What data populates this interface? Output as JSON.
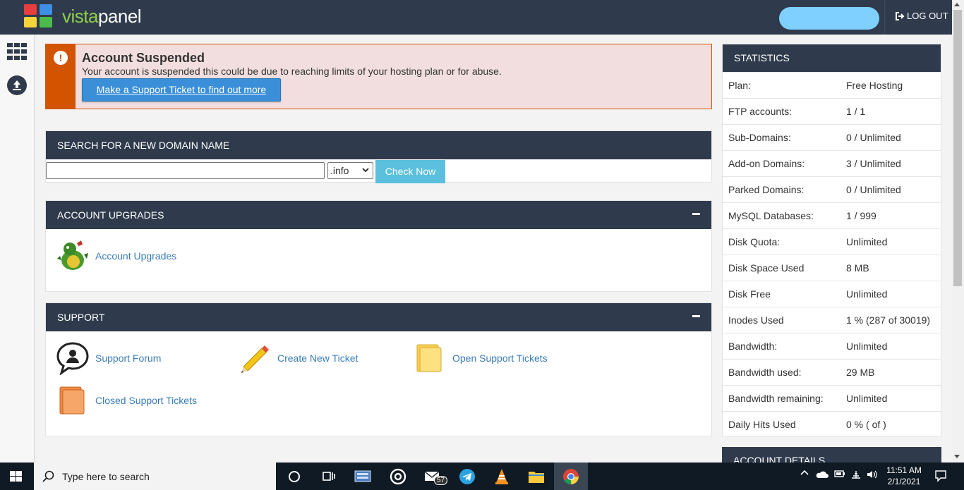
{
  "header": {
    "logo_text": "vistapanel",
    "logout_label": "LOG OUT"
  },
  "alert": {
    "title": "Account Suspended",
    "message": "Your account is suspended this could be due to reaching limits of your hosting plan or for abuse.",
    "button_label": "Make a Support Ticket to find out more"
  },
  "domain_search": {
    "heading": "SEARCH FOR A NEW DOMAIN NAME",
    "input_value": "",
    "tld_selected": ".info",
    "button_label": "Check Now"
  },
  "upgrades": {
    "heading": "ACCOUNT UPGRADES",
    "link_label": "Account Upgrades"
  },
  "support": {
    "heading": "SUPPORT",
    "forum": "Support Forum",
    "new_ticket": "Create New Ticket",
    "open_tickets": "Open Support Tickets",
    "closed_tickets": "Closed Support Tickets"
  },
  "statistics": {
    "heading": "STATISTICS",
    "rows": [
      {
        "label": "Plan:",
        "value": "Free Hosting"
      },
      {
        "label": "FTP accounts:",
        "value": "1 / 1"
      },
      {
        "label": "Sub-Domains:",
        "value": "0 / Unlimited"
      },
      {
        "label": "Add-on Domains:",
        "value": "3 / Unlimited"
      },
      {
        "label": "Parked Domains:",
        "value": "0 / Unlimited"
      },
      {
        "label": "MySQL Databases:",
        "value": "1 / 999"
      },
      {
        "label": "Disk Quota:",
        "value": "Unlimited"
      },
      {
        "label": "Disk Space Used",
        "value": "8 MB"
      },
      {
        "label": "Disk Free",
        "value": "Unlimited"
      },
      {
        "label": "Inodes Used",
        "value": "1 % (287 of 30019)"
      },
      {
        "label": "Bandwidth:",
        "value": "Unlimited"
      },
      {
        "label": "Bandwidth used:",
        "value": "29 MB"
      },
      {
        "label": "Bandwidth remaining:",
        "value": "Unlimited"
      },
      {
        "label": "Daily Hits Used",
        "value": "0 % ( of )"
      }
    ]
  },
  "account_details": {
    "heading": "ACCOUNT DETAILS"
  },
  "taskbar": {
    "search_placeholder": "Type here to search",
    "mail_badge": "57",
    "time": "11:51 AM",
    "date": "2/1/2021"
  }
}
